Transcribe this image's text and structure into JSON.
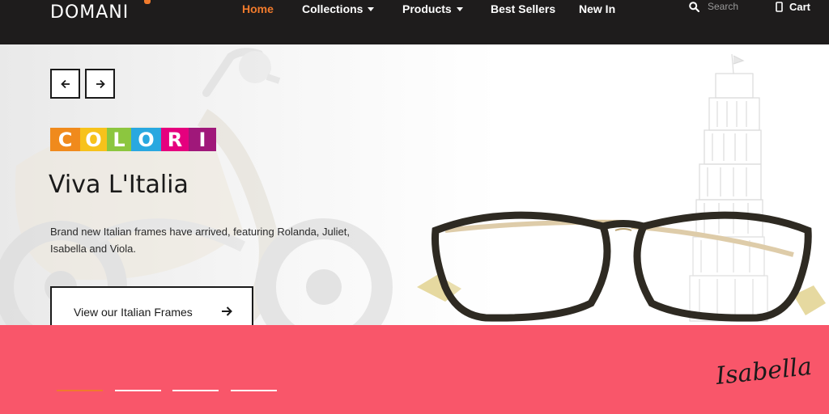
{
  "header": {
    "logo": "DOMANI",
    "nav": [
      {
        "label": "Home",
        "active": true
      },
      {
        "label": "Collections",
        "dropdown": true
      },
      {
        "label": "Products",
        "dropdown": true
      },
      {
        "label": "Best Sellers"
      },
      {
        "label": "New In"
      }
    ],
    "search_placeholder": "Search",
    "cart_label": "Cart",
    "colors": {
      "background": "#1e1c1c",
      "active": "#f07a2c"
    }
  },
  "hero": {
    "brand_letters": [
      "C",
      "O",
      "L",
      "O",
      "R",
      "I"
    ],
    "brand_colors": [
      "#f08a1c",
      "#f7c21b",
      "#8cc63f",
      "#29a8e0",
      "#e5007e",
      "#a0187a"
    ],
    "title": "Viva L'Italia",
    "description": "Brand new Italian frames have arrived, featuring Rolanda, Juliet, Isabella and Viola.",
    "cta_label": "View our Italian Frames"
  },
  "band": {
    "color": "#f9566a",
    "signature": "Isabella",
    "slides": 4,
    "active_slide": 1
  },
  "icons": [
    "arrow-left-icon",
    "arrow-right-icon",
    "search-icon",
    "cart-icon",
    "arrow-right-icon"
  ]
}
